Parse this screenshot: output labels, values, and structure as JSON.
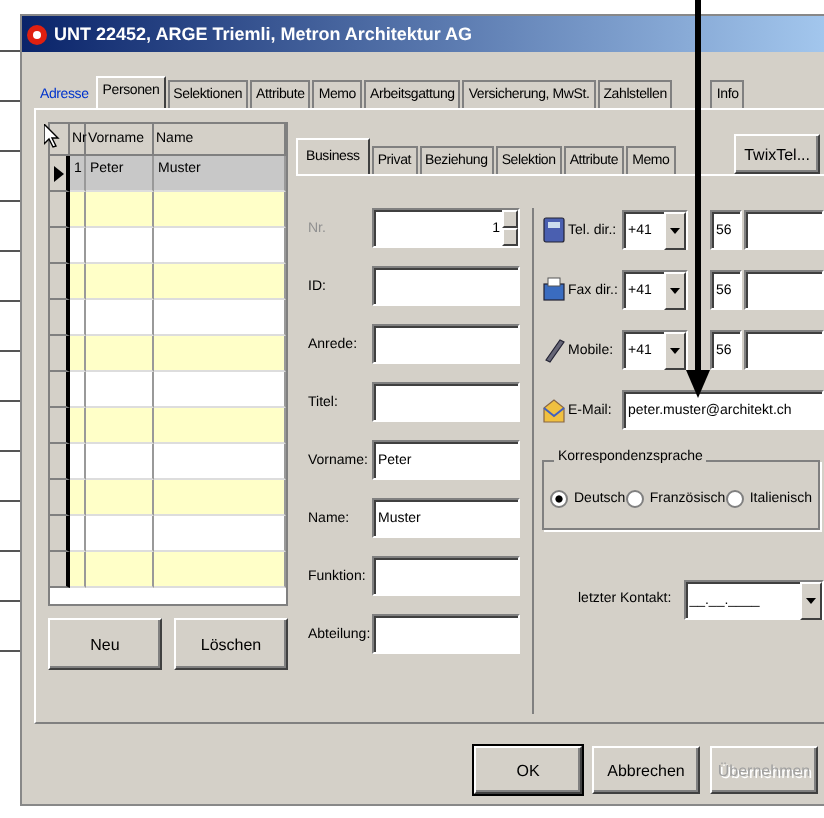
{
  "window": {
    "title": "UNT 22452, ARGE Triemli, Metron Architektur AG"
  },
  "tabs": [
    {
      "label": "Adresse",
      "selected": false,
      "hover": true
    },
    {
      "label": "Personen",
      "selected": true,
      "hover": false
    },
    {
      "label": "Selektionen",
      "selected": false,
      "hover": false
    },
    {
      "label": "Attribute",
      "selected": false,
      "hover": false
    },
    {
      "label": "Memo",
      "selected": false,
      "hover": false
    },
    {
      "label": "Arbeitsgattung",
      "selected": false,
      "hover": false
    },
    {
      "label": "Versicherung, MwSt.",
      "selected": false,
      "hover": false
    },
    {
      "label": "Zahlstellen",
      "selected": false,
      "hover": false
    },
    {
      "label": "Info",
      "selected": false,
      "hover": false
    }
  ],
  "persons_grid": {
    "columns": [
      "Nr",
      "Vorname",
      "Name"
    ],
    "rows": [
      {
        "nr": "1",
        "vorname": "Peter",
        "name": "Muster",
        "selected": true
      },
      {
        "selected": false
      },
      {
        "selected": false
      },
      {
        "selected": false
      },
      {
        "selected": false
      },
      {
        "selected": false
      },
      {
        "selected": false
      },
      {
        "selected": false
      },
      {
        "selected": false
      },
      {
        "selected": false
      },
      {
        "selected": false
      },
      {
        "selected": false
      }
    ]
  },
  "grid_buttons": [
    "Neu",
    "Löschen"
  ],
  "subtabs": [
    {
      "label": "Business",
      "selected": true
    },
    {
      "label": "Privat",
      "selected": false
    },
    {
      "label": "Beziehung",
      "selected": false
    },
    {
      "label": "Selektion",
      "selected": false
    },
    {
      "label": "Attribute",
      "selected": false
    },
    {
      "label": "Memo",
      "selected": false
    }
  ],
  "twixtel_button": "TwixTel...",
  "fields": [
    {
      "label": "Nr.",
      "value": "1",
      "disabled": true,
      "kind": "spin"
    },
    {
      "label": "ID:",
      "disabled": false,
      "kind": "text"
    },
    {
      "label": "Anrede:",
      "disabled": false,
      "kind": "text"
    },
    {
      "label": "Titel:",
      "disabled": false,
      "kind": "text"
    },
    {
      "label": "Vorname:",
      "value": "Peter",
      "disabled": false,
      "kind": "text"
    },
    {
      "label": "Name:",
      "value": "Muster",
      "disabled": false,
      "kind": "text"
    },
    {
      "label": "Funktion:",
      "disabled": false,
      "kind": "text"
    },
    {
      "label": "Abteilung:",
      "disabled": false,
      "kind": "text"
    }
  ],
  "contacts": [
    {
      "kind": "phone",
      "label": "Tel. dir.:",
      "country": "+41",
      "area": "56"
    },
    {
      "kind": "fax",
      "label": "Fax dir.:",
      "country": "+41",
      "area": "56"
    },
    {
      "kind": "mobile",
      "label": "Mobile:",
      "country": "+41",
      "area": "56"
    },
    {
      "kind": "email",
      "label": "E-Mail:",
      "value": "peter.muster@architekt.ch"
    }
  ],
  "correspondence_language": {
    "title": "Korrespondenzsprache",
    "options": [
      {
        "label": "Deutsch",
        "selected": true
      },
      {
        "label": "Französisch",
        "selected": false
      },
      {
        "label": "Italienisch",
        "selected": false
      }
    ]
  },
  "last_contact": {
    "label": "letzter Kontakt:",
    "value": "__.__.____"
  },
  "buttons": [
    {
      "label": "OK",
      "disabled": false,
      "default": true
    },
    {
      "label": "Abbrechen",
      "disabled": false,
      "default": false
    },
    {
      "label": "Übernehmen",
      "disabled": true,
      "default": false
    }
  ]
}
